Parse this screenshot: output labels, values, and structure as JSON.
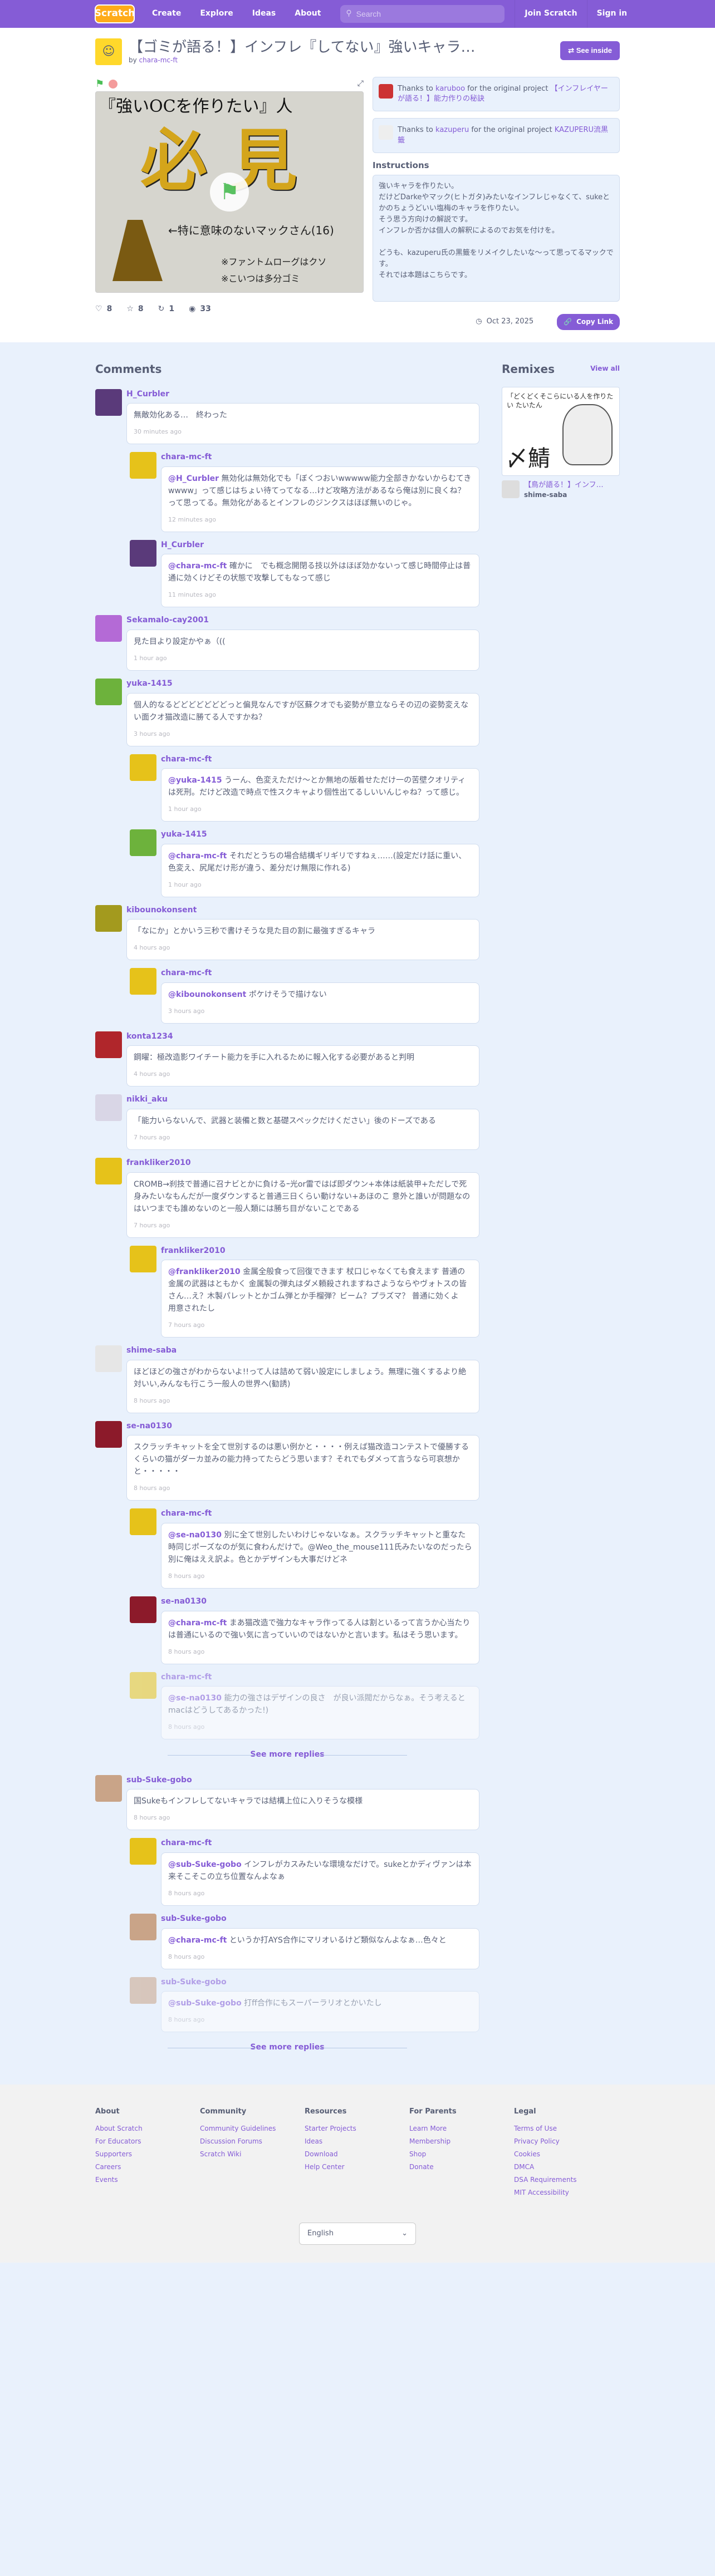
{
  "nav": {
    "logo": "Scratch",
    "create": "Create",
    "explore": "Explore",
    "ideas": "Ideas",
    "about": "About",
    "search_placeholder": "Search",
    "join": "Join Scratch",
    "signin": "Sign in"
  },
  "project": {
    "title": "【ゴミが語る！】インフレ『してない』強いキャラ…",
    "by": "by",
    "author": "chara-mc-ft",
    "see_inside": "See inside",
    "stage": {
      "line1": "『強いOCを作りたい』人",
      "big": "必 見",
      "line2": "←特に意味のないマックさん(16)",
      "line3": "※ファントムローグはクソ",
      "line4": "※こいつは多分ゴミ"
    },
    "thanks1": {
      "pre": "Thanks to",
      "user": "karuboo",
      "mid": "for the original project",
      "proj": "【インフレイヤーが語る！】能力作りの秘訣"
    },
    "thanks2": {
      "pre": "Thanks to",
      "user": "kazuperu",
      "mid": "for the original project",
      "proj": "KAZUPERU流黒籤"
    },
    "instructions_title": "Instructions",
    "instructions": "強いキャラを作りたい。\nだけどDarkeやマック(ヒトガタ)みたいなインフレじゃなくて、sukeとかのちょうどいい塩梅のキャラを作りたい。\nそう思う方向けの解説です。\nインフレか否かは個人の解釈によるのでお気を付けを。\n\nどうも、kazuperu氏の黒籤をリメイクしたいな〜って思ってるマックです。\nそれでは本題はこちらです。",
    "stats": {
      "loves": "8",
      "favs": "8",
      "remixes": "1",
      "views": "33"
    },
    "date": "Oct 23, 2025",
    "copy_link": "Copy Link"
  },
  "comments_title": "Comments",
  "comments": [
    {
      "user": "H_Curbler",
      "text": "無敵効化ある…　終わった",
      "time": "30 minutes ago",
      "color": "#5a3a7a",
      "replies": [
        {
          "user": "chara-mc-ft",
          "mention": "@H_Curbler",
          "text": "無効化は無効化でも「ぼくつおいwwwww能力全部きかないからむてきwwww」って感じはちょい待てってなる…けど攻略方法があるなら俺は別に良くね？って思ってる。無効化があるとインフレのジンクスはほぼ無いのじゃ。",
          "time": "12 minutes ago",
          "color": "#e6c21a"
        },
        {
          "user": "H_Curbler",
          "mention": "@chara-mc-ft",
          "text": "確かに　でも概念開閉る技以外はほぼ効かないって感じ時間停止は普通に効くけどその状態で攻撃してもなって感じ",
          "time": "11 minutes ago",
          "color": "#5a3a7a"
        }
      ]
    },
    {
      "user": "Sekamalo-cay2001",
      "text": "見た目より設定かやぁ（((",
      "time": "1 hour ago",
      "color": "#b46ad6",
      "replies": []
    },
    {
      "user": "yuka-1415",
      "text": "個人的なるどどどどどどどっと偏見なんですが区蘇クオでも姿勢が意立ならその辺の姿勢変えない面クオ猫改造に勝てる人ですかね？",
      "time": "3 hours ago",
      "color": "#6db23c",
      "replies": [
        {
          "user": "chara-mc-ft",
          "mention": "@yuka-1415",
          "text": "うーん、色変えただけ〜とか無地の版着せただけ一の苦壁クオリティは死刑。だけど改造で時点で性スクキャより個性出てるしいいんじゃね？って感じ。",
          "time": "1 hour ago",
          "color": "#e6c21a"
        },
        {
          "user": "yuka-1415",
          "mention": "@chara-mc-ft",
          "text": "それだとうちの場合結構ギリギリですねぇ……(設定だけ話に重い、色変え、尻尾だけ形が違う、差分だけ無限に作れる)",
          "time": "1 hour ago",
          "color": "#6db23c"
        }
      ]
    },
    {
      "user": "kibounokonsent",
      "text": "「なにか」とかいう三秒で書けそうな見た目の割に最強すぎるキャラ",
      "time": "4 hours ago",
      "color": "#a39a1e",
      "replies": [
        {
          "user": "chara-mc-ft",
          "mention": "@kibounokonsent",
          "text": "ポケけそうで描けない",
          "time": "3 hours ago",
          "color": "#e6c21a"
        }
      ]
    },
    {
      "user": "konta1234",
      "text": "鋼曜：極改造影ワイチート能力を手に入れるために報入化する必要があると判明",
      "time": "4 hours ago",
      "color": "#b0262b",
      "replies": []
    },
    {
      "user": "nikki_aku",
      "text": "「能力いらないんで、武器と装備と数と基礎スペックだけください」後のドーズである",
      "time": "7 hours ago",
      "color": "#d9d6e6",
      "replies": []
    },
    {
      "user": "frankliker2010",
      "text": "CROMB→刹技で普通に召ナビとかに負けるｰ光or雷ではば即ダウン+本体は紙装甲+ただしで死身みたいなもんだが一度ダウンすると普通三日くらい動けない+あほのこ 意外と誰いが問題なのはいつまでも誰めないのと一般人類には勝ち目がないことである",
      "time": "7 hours ago",
      "color": "#e6c21a",
      "replies": [
        {
          "user": "frankliker2010",
          "mention": "@frankliker2010",
          "text": "金属全般食って回復できます 杖口じゃなくても食えます 普通の金属の武器はともかく 金属製の弾丸はダメ頼殺されますねさようならやヴォトスの皆さん…え？木製パレットとかゴム弾とか手榴弾？ビーム？プラズマ？ 普通に効くよ　用意されたし",
          "time": "7 hours ago",
          "color": "#e6c21a"
        }
      ]
    },
    {
      "user": "shime-saba",
      "text": "ほどほどの強さがわからないよ!!って人は詰めて弱い設定にしましょう。無理に強くするより絶対いい,みんなも行こう一般人の世界へ(勧誘)",
      "time": "8 hours ago",
      "color": "#e6e6e6",
      "replies": []
    },
    {
      "user": "se-na0130",
      "text": "スクラッチキャットを全て世別するのは悪い例かと・・・・例えば猫改造コンテストで優勝するくらいの猫がダーカ並みの能力持ってたらどう思います？それでもダメって言うなら可哀想かと・・・・・",
      "time": "8 hours ago",
      "color": "#8c1a2a",
      "replies": [
        {
          "user": "chara-mc-ft",
          "mention": "@se-na0130",
          "text": "別に全て世別したいわけじゃないなぁ。スクラッチキャットと重なた時同じポーズなのが気に食わんだけで。@Weo_the_mouse111氏みたいなのだったら別に俺はええ訳よ。色とかデザインも大事だけどネ",
          "time": "8 hours ago",
          "color": "#e6c21a"
        },
        {
          "user": "se-na0130",
          "mention": "@chara-mc-ft",
          "text": "まあ猫改造で強力なキャラ作ってる人は割といるって言うか心当たりは普通にいるので強い気に言っていいのではないかと言います。私はそう思います。",
          "time": "8 hours ago",
          "color": "#8c1a2a"
        },
        {
          "user": "chara-mc-ft",
          "mention": "@se-na0130",
          "text": "能力の強さはデザインの良さ　が良い派閥だからなぁ。そう考えるとmacはどうしてあるかった!)",
          "time": "8 hours ago",
          "color": "#e6c21a",
          "fade": true
        }
      ]
    },
    {
      "user": "sub-Suke-gobo",
      "text": "国Sukeもインフレしてないキャラでは結構上位に入りそうな模様",
      "time": "8 hours ago",
      "color": "#c9a488",
      "replies": [
        {
          "user": "chara-mc-ft",
          "mention": "@sub-Suke-gobo",
          "text": "インフレがカスみたいな環境なだけで。sukeとかディヴァンは本来そこそこの立ち位置なんよなぁ",
          "time": "8 hours ago",
          "color": "#e6c21a"
        },
        {
          "user": "sub-Suke-gobo",
          "mention": "@chara-mc-ft",
          "text": "というか打AYS合作にマリオいるけど類似なんよなぁ…色々と",
          "time": "8 hours ago",
          "color": "#c9a488"
        },
        {
          "user": "sub-Suke-gobo",
          "mention": "@sub-Suke-gobo",
          "text": "打ff合作にもスーパーラリオとかいたし",
          "time": "8 hours ago",
          "color": "#c9a488",
          "fade": true
        }
      ]
    }
  ],
  "see_more_replies": "See more replies",
  "see_more_replies2": "See more replies",
  "remixes": {
    "title": "Remixes",
    "view_all": "View all",
    "img_text": "「どくどくそこらにいる人を作りたい  たいたん",
    "img_big": "〆鯖",
    "proj_title": "【鳥が語る！】インフ…",
    "proj_author": "shime-saba"
  },
  "footer": {
    "cols": [
      {
        "h": "About",
        "items": [
          "About Scratch",
          "For Educators",
          "Supporters",
          "Careers",
          "Events"
        ]
      },
      {
        "h": "Community",
        "items": [
          "Community Guidelines",
          "Discussion Forums",
          "Scratch Wiki"
        ]
      },
      {
        "h": "Resources",
        "items": [
          "Starter Projects",
          "Ideas",
          "Download",
          "Help Center"
        ]
      },
      {
        "h": "For Parents",
        "items": [
          "Learn More",
          "Membership",
          "Shop",
          "Donate"
        ]
      },
      {
        "h": "Legal",
        "items": [
          "Terms of Use",
          "Privacy Policy",
          "Cookies",
          "DMCA",
          "DSA Requirements",
          "MIT Accessibility"
        ]
      }
    ],
    "language": "English"
  }
}
